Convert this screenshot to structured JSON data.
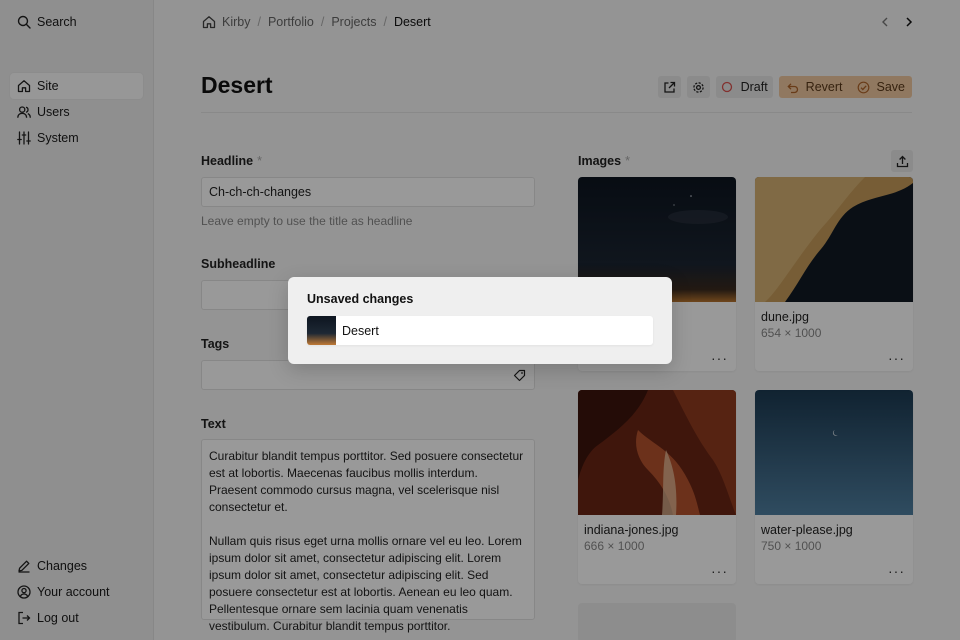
{
  "sidebar": {
    "search": {
      "label": "Search",
      "icon": "search-icon"
    },
    "menu": [
      {
        "label": "Site",
        "icon": "home-icon",
        "active": true
      },
      {
        "label": "Users",
        "icon": "users-icon",
        "active": false
      },
      {
        "label": "System",
        "icon": "settings-sliders-icon",
        "active": false
      }
    ],
    "bottom": [
      {
        "label": "Changes",
        "icon": "pen-icon"
      },
      {
        "label": "Your account",
        "icon": "account-icon"
      },
      {
        "label": "Log out",
        "icon": "logout-icon"
      }
    ]
  },
  "breadcrumb": {
    "items": [
      "Kirby",
      "Portfolio",
      "Projects",
      "Desert"
    ]
  },
  "page": {
    "title": "Desert",
    "toolbar": {
      "status_label": "Draft",
      "revert_label": "Revert",
      "save_label": "Save"
    }
  },
  "fields": {
    "headline": {
      "label": "Headline",
      "required_mark": "*",
      "value": "Ch-ch-ch-changes",
      "help": "Leave empty to use the title as headline"
    },
    "subheadline": {
      "label": "Subheadline",
      "value": ""
    },
    "tags": {
      "label": "Tags",
      "value": ""
    },
    "text": {
      "label": "Text",
      "value": "Curabitur blandit tempus porttitor. Sed posuere consectetur est at lobortis. Maecenas faucibus mollis interdum. Praesent commodo cursus magna, vel scelerisque nisl consectetur et.\n\nNullam quis risus eget urna mollis ornare vel eu leo. Lorem ipsum dolor sit amet, consectetur adipiscing elit. Lorem ipsum dolor sit amet, consectetur adipiscing elit. Sed posuere consectetur est at lobortis. Aenean eu leo quam. Pellentesque ornare sem lacinia quam venenatis vestibulum. Curabitur blandit tempus porttitor."
    }
  },
  "images": {
    "label": "Images",
    "required_mark": "*",
    "files": [
      {
        "name": "",
        "dims": ""
      },
      {
        "name": "dune.jpg",
        "dims": "654 × 1000"
      },
      {
        "name": "indiana-jones.jpg",
        "dims": "666 × 1000"
      },
      {
        "name": "water-please.jpg",
        "dims": "750 × 1000"
      }
    ],
    "more_glyph": "···"
  },
  "dialog": {
    "title": "Unsaved changes",
    "items": [
      {
        "label": "Desert"
      }
    ]
  },
  "colors": {
    "accent_orange": "#f1c8a1",
    "draft_red": "#d9534f",
    "overlay": "rgba(0,0,0,0.40)"
  }
}
